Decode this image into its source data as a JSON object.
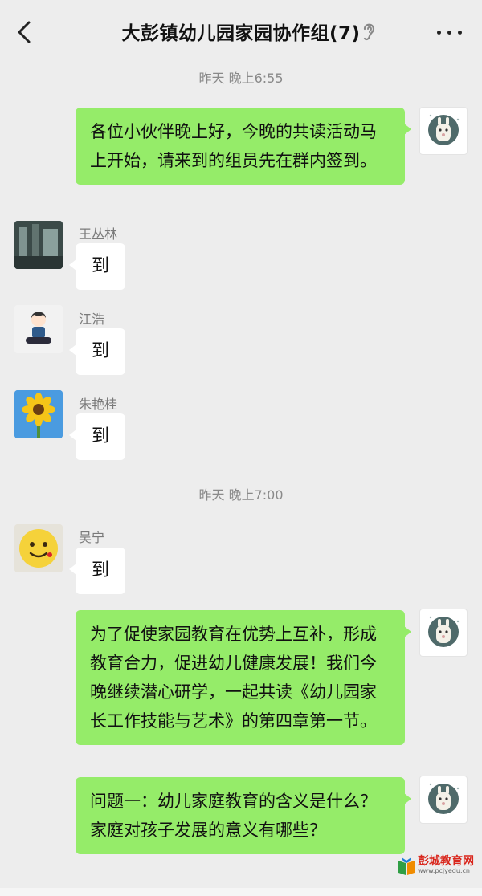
{
  "header": {
    "title": "大彭镇幼儿园家园协作组(7)",
    "back_icon": "chevron-left-icon",
    "ear_icon": "ear-icon",
    "more_icon": "more-icon"
  },
  "timestamps": [
    "昨天 晚上6:55",
    "昨天 晚上7:00"
  ],
  "messages": [
    {
      "sender": "",
      "from_me": true,
      "text": "各位小伙伴晚上好，今晚的共读活动马上开始，请来到的组员先在群内签到。"
    },
    {
      "sender": "王丛林",
      "from_me": false,
      "text": "到"
    },
    {
      "sender": "江浩",
      "from_me": false,
      "text": "到"
    },
    {
      "sender": "朱艳桂",
      "from_me": false,
      "text": "到"
    },
    {
      "sender": "吴宁",
      "from_me": false,
      "text": "到"
    },
    {
      "sender": "",
      "from_me": true,
      "text": "为了促使家园教育在优势上互补，形成教育合力，促进幼儿健康发展！我们今晚继续潜心研学，一起共读《幼儿园家长工作技能与艺术》的第四章第一节。"
    },
    {
      "sender": "",
      "from_me": true,
      "text": "问题一：幼儿家庭教育的含义是什么？家庭对孩子发展的意义有哪些？"
    }
  ],
  "watermark": {
    "text": "彭城教育网",
    "url": "www.pcjyedu.cn"
  },
  "colors": {
    "background": "#ededed",
    "my_bubble": "#95ec69",
    "their_bubble": "#ffffff",
    "meta_text": "#8a8a8a"
  }
}
